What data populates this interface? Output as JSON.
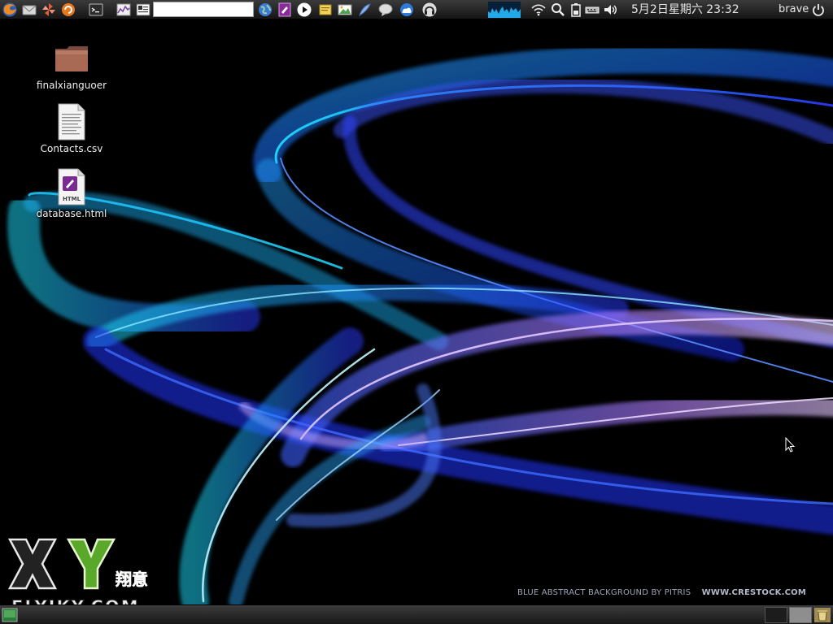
{
  "top_panel": {
    "search": {
      "value": ""
    },
    "clock": "5月2日星期六 23:32",
    "user": "brave"
  },
  "desktop": {
    "icons": [
      {
        "label": "finalxianguoer",
        "icon": "folder-icon"
      },
      {
        "label": "Contacts.csv",
        "icon": "text-file-icon"
      },
      {
        "label": "database.html",
        "icon": "html-file-icon",
        "badge": "HTML"
      }
    ]
  },
  "wallpaper": {
    "credit": "BLUE ABSTRACT BACKGROUND BY PITRIS",
    "credit_url": "WWW.CRESTOCK.COM"
  },
  "watermark": {
    "letters": "XY",
    "chinese": "翔意",
    "site": "FLYIKY.COM"
  },
  "colors": {
    "panel": "#222222",
    "wallpaper_bg": "#000000",
    "ribbon_cyan": "#2ad8ff",
    "ribbon_blue": "#2740ff",
    "ribbon_violet": "#a070ff",
    "logo_green": "#5aa82a"
  }
}
